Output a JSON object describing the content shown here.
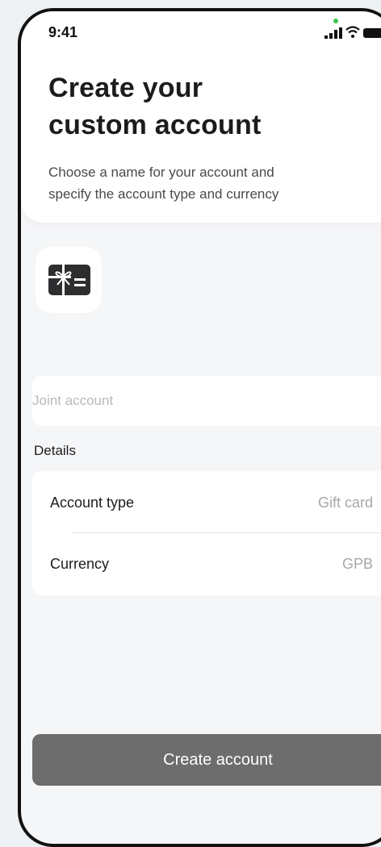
{
  "status_bar": {
    "time": "9:41"
  },
  "header": {
    "title_lines": [
      "Create your",
      "custom account"
    ],
    "subtitle_lines": [
      "Choose a name for your account and",
      "specify the account type and currency"
    ]
  },
  "account_icon": {
    "icon": "gift-card-icon"
  },
  "name_input": {
    "placeholder": "Joint account",
    "value": ""
  },
  "details": {
    "section_label": "Details",
    "rows": [
      {
        "label": "Account type",
        "value": "Gift card"
      },
      {
        "label": "Currency",
        "value": "GPB"
      }
    ]
  },
  "actions": {
    "create_label": "Create account"
  },
  "colors": {
    "background": "#f5f6f8",
    "card": "#ffffff",
    "button": "#6d6d6d",
    "muted_text": "#a6a8ad",
    "camera_dot": "#3cc54a"
  }
}
